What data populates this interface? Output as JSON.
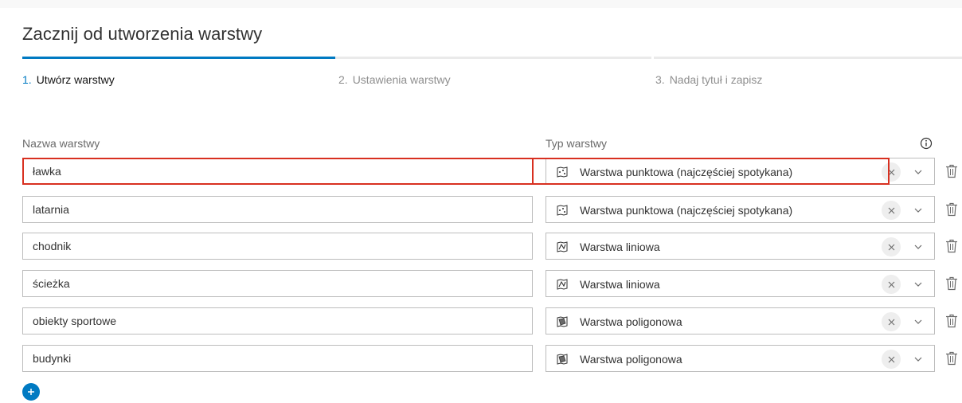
{
  "header": {
    "title": "Zacznij od utworzenia warstwy"
  },
  "steps": [
    {
      "num": "1.",
      "label": "Utwórz warstwy",
      "state": "active"
    },
    {
      "num": "2.",
      "label": "Ustawienia warstwy",
      "state": "inactive"
    },
    {
      "num": "3.",
      "label": "Nadaj tytuł i zapisz",
      "state": "inactive"
    }
  ],
  "columns": {
    "name": "Nazwa warstwy",
    "type": "Typ warstwy"
  },
  "layers": [
    {
      "name": "ławka",
      "type": "Warstwa punktowa (najczęściej spotykana)",
      "icon": "point-layer-icon"
    },
    {
      "name": "latarnia",
      "type": "Warstwa punktowa (najczęściej spotykana)",
      "icon": "point-layer-icon"
    },
    {
      "name": "chodnik",
      "type": "Warstwa liniowa",
      "icon": "line-layer-icon"
    },
    {
      "name": "ścieżka",
      "type": "Warstwa liniowa",
      "icon": "line-layer-icon"
    },
    {
      "name": "obiekty sportowe",
      "type": "Warstwa poligonowa",
      "icon": "polygon-layer-icon"
    },
    {
      "name": "budynki",
      "type": "Warstwa poligonowa",
      "icon": "polygon-layer-icon"
    }
  ],
  "colors": {
    "accent": "#007ac2",
    "highlight": "#d83020"
  }
}
